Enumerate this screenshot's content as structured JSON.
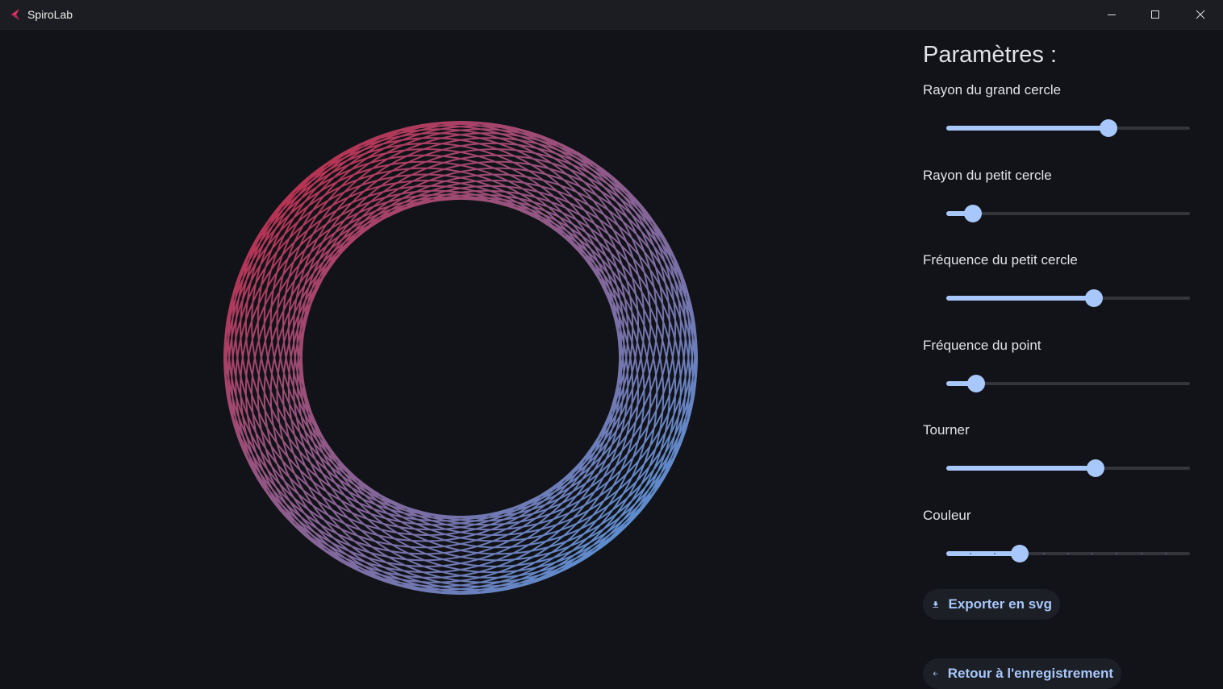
{
  "window": {
    "title": "SpiroLab"
  },
  "panel": {
    "title": "Paramètres :",
    "sliders": [
      {
        "label": "Rayon du grand cercle",
        "value": 0.667
      },
      {
        "label": "Rayon du petit cercle",
        "value": 0.11
      },
      {
        "label": "Fréquence du petit cercle",
        "value": 0.607
      },
      {
        "label": "Fréquence du point",
        "value": 0.121
      },
      {
        "label": "Tourner",
        "value": 0.613
      },
      {
        "label": "Couleur",
        "value": 0.3,
        "discrete": true,
        "steps": 10
      }
    ],
    "export_button": {
      "label": "Exporter en svg",
      "icon": "download-icon"
    },
    "back_button": {
      "label": "Retour à l'enregistrement",
      "icon": "arrow-back-icon"
    }
  },
  "spirograph": {
    "color_start": "#c8213a",
    "color_end": "#4c9ee6",
    "outer_period": 37,
    "wave_count": 36,
    "loops": 37
  },
  "colors": {
    "accent": "#a8c7fa",
    "background": "#111318",
    "titlebar": "#1b1d22"
  }
}
